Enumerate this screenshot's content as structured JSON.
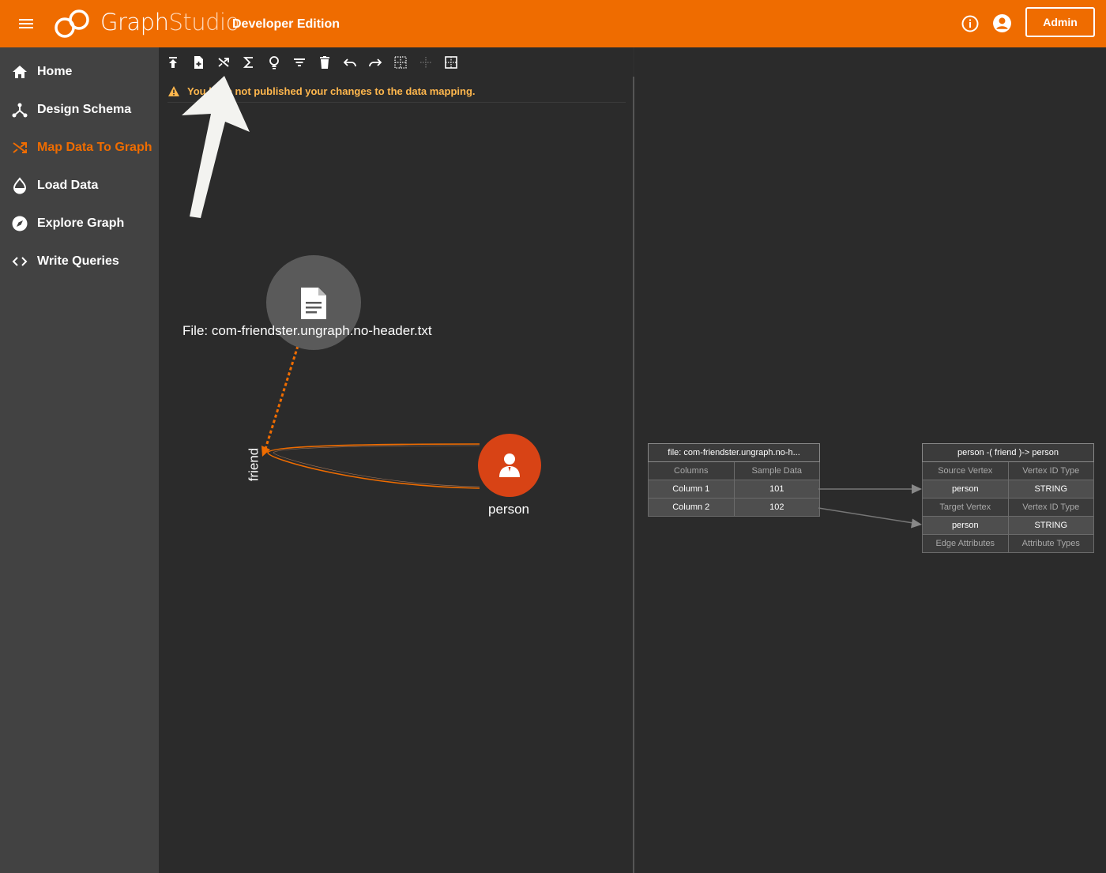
{
  "header": {
    "brand_primary": "Graph",
    "brand_secondary": "Studio",
    "edition": "Developer Edition",
    "admin_label": "Admin",
    "accent": "#ef6c00"
  },
  "sidebar": {
    "items": [
      {
        "label": "Home",
        "icon": "home-icon"
      },
      {
        "label": "Design Schema",
        "icon": "schema-icon"
      },
      {
        "label": "Map Data To Graph",
        "icon": "shuffle-icon",
        "active": true
      },
      {
        "label": "Load Data",
        "icon": "drop-icon"
      },
      {
        "label": "Explore Graph",
        "icon": "compass-icon"
      },
      {
        "label": "Write Queries",
        "icon": "code-icon"
      }
    ]
  },
  "toolbar": {
    "icons": [
      "publish-icon",
      "add-file-icon",
      "map-icon",
      "sum-icon",
      "lightbulb-icon",
      "filter-icon",
      "delete-icon",
      "undo-icon",
      "redo-icon",
      "grid-icon",
      "grid-dim-icon",
      "grid-outline-icon"
    ]
  },
  "warning": {
    "text": "You have not published your changes to the data mapping."
  },
  "graph": {
    "file_label": "File: com-friendster.ungraph.no-header.txt",
    "edge_label": "friend",
    "vertex_label": "person"
  },
  "source_table": {
    "title": "file: com-friendster.ungraph.no-h...",
    "col_headers": [
      "Columns",
      "Sample Data"
    ],
    "rows": [
      [
        "Column 1",
        "101"
      ],
      [
        "Column 2",
        "102"
      ]
    ]
  },
  "edge_table": {
    "title": "person -( friend )-> person",
    "source_header": [
      "Source Vertex",
      "Vertex ID Type"
    ],
    "source_values": [
      "person",
      "STRING"
    ],
    "target_header": [
      "Target Vertex",
      "Vertex ID Type"
    ],
    "target_values": [
      "person",
      "STRING"
    ],
    "attr_header": [
      "Edge Attributes",
      "Attribute Types"
    ]
  }
}
